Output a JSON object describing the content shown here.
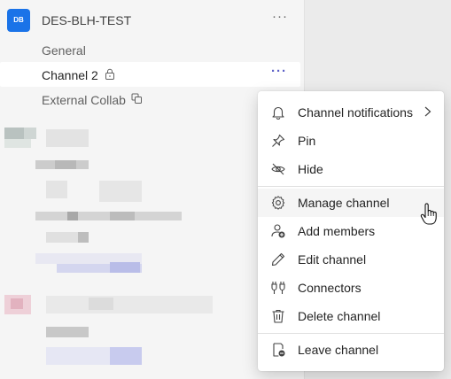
{
  "team": {
    "avatar_text": "DB",
    "name": "DES-BLH-TEST",
    "more_icon": "more-horizontal-icon",
    "avatar_color": "#1a73e8"
  },
  "channels": [
    {
      "label": "General",
      "icon": null,
      "selected": false
    },
    {
      "label": "Channel 2",
      "icon": "lock-icon",
      "selected": true
    },
    {
      "label": "External Collab",
      "icon": "shared-channel-icon",
      "selected": false
    }
  ],
  "context_menu": {
    "items": [
      {
        "label": "Channel notifications",
        "icon": "bell-icon",
        "has_submenu": true
      },
      {
        "label": "Pin",
        "icon": "pin-icon"
      },
      {
        "label": "Hide",
        "icon": "eye-off-icon"
      },
      {
        "label": "Manage channel",
        "icon": "gear-icon",
        "hovered": true
      },
      {
        "label": "Add members",
        "icon": "person-add-icon"
      },
      {
        "label": "Edit channel",
        "icon": "pencil-icon"
      },
      {
        "label": "Connectors",
        "icon": "plug-icon"
      },
      {
        "label": "Delete channel",
        "icon": "trash-icon"
      },
      {
        "label": "Leave channel",
        "icon": "leave-icon"
      }
    ]
  },
  "colors": {
    "accent": "#5b5fc7",
    "menu_hover": "#f5f5f5"
  }
}
